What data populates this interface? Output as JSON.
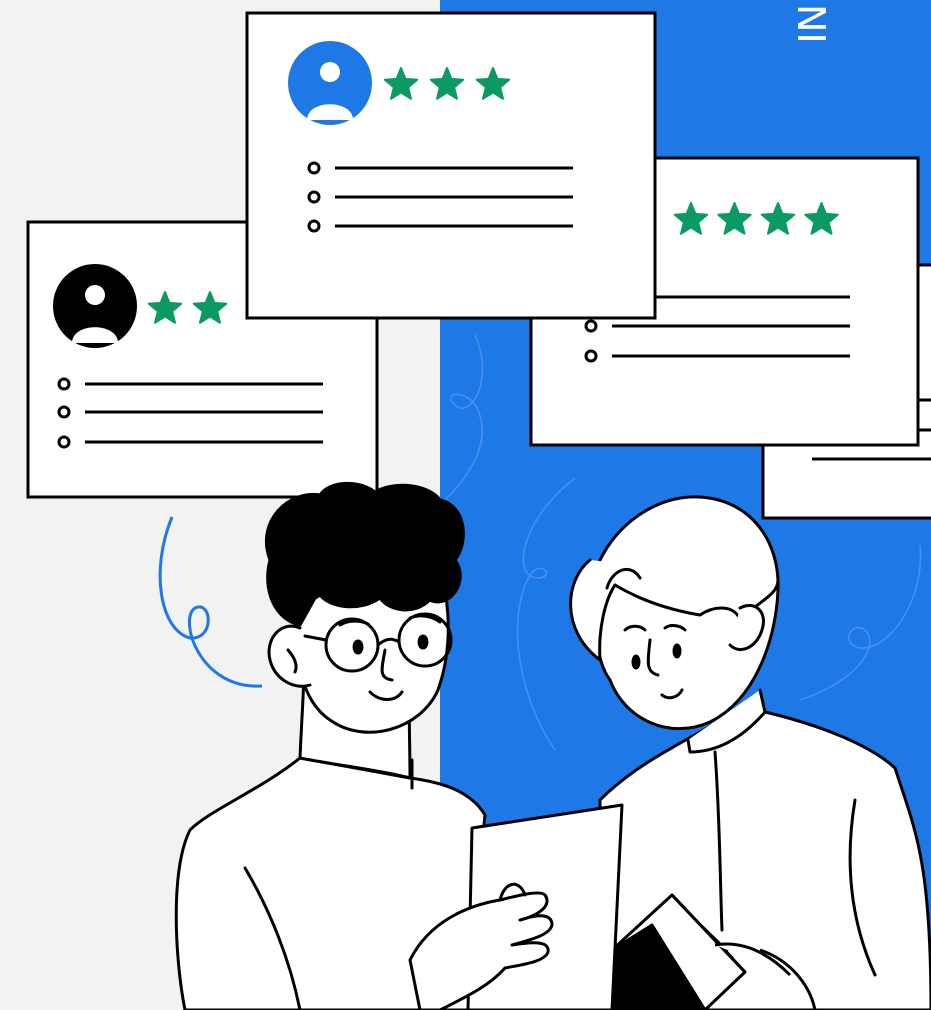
{
  "colors": {
    "background": "#f2f2f2",
    "accent_blue": "#1e78e6",
    "star_green": "#0a9a62",
    "ink": "#000000",
    "paper": "#ffffff"
  },
  "banner": {
    "vertical_text": "NI"
  },
  "review_cards": [
    {
      "name": "review-card-blue-avatar",
      "avatar_color": "#1e78e6",
      "rating": 3,
      "text_lines": 3
    },
    {
      "name": "review-card-black-avatar",
      "avatar_color": "#000000",
      "rating": 2,
      "text_lines": 3
    },
    {
      "name": "review-card-right",
      "rating": 4,
      "text_lines": 3
    }
  ],
  "icons": [
    "user-avatar-icon",
    "star-icon",
    "bullet-icon"
  ]
}
